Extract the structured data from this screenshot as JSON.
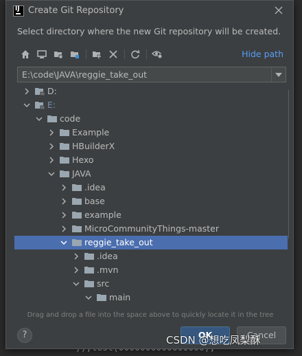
{
  "dialog": {
    "title": "Create Git Repository",
    "description": "Select directory where the new Git repository will be created.",
    "hide_path_label": "Hide path",
    "path_value": "E:\\code\\JAVA\\reggie_take_out",
    "hint": "Drag and drop a file into the space above to quickly locate it in the tree",
    "help_label": "?",
    "ok_label": "OK",
    "cancel_label": "Cancel"
  },
  "toolbar_icons": [
    "home-icon",
    "desktop-icon",
    "project-folder-icon",
    "module-folder-icon",
    "new-folder-icon",
    "delete-icon",
    "refresh-icon",
    "show-hidden-icon"
  ],
  "tree": {
    "items": [
      {
        "label": "D:",
        "expanded": false,
        "drive": true
      },
      {
        "label": "E:",
        "expanded": true,
        "drive": true
      },
      {
        "label": "code",
        "expanded": true
      },
      {
        "label": "Example",
        "expanded": false
      },
      {
        "label": "HBuilderX",
        "expanded": false
      },
      {
        "label": "Hexo",
        "expanded": false
      },
      {
        "label": "JAVA",
        "expanded": true
      },
      {
        "label": ".idea",
        "expanded": false
      },
      {
        "label": "base",
        "expanded": false
      },
      {
        "label": "example",
        "expanded": false
      },
      {
        "label": "MicroCommunityThings-master",
        "expanded": false
      },
      {
        "label": "reggie_take_out",
        "expanded": true,
        "selected": true
      },
      {
        "label": ".idea",
        "expanded": false
      },
      {
        "label": ".mvn",
        "expanded": false
      },
      {
        "label": "src",
        "expanded": true
      },
      {
        "label": "main",
        "expanded": true
      }
    ]
  },
  "editor": {
    "bottom_line": "));test(0000000000000000);"
  },
  "watermark": "CSDN @想吃凤梨酥",
  "colors": {
    "accent": "#589df6",
    "selection": "#4b6eaf",
    "ok_button": "#365880",
    "folder": "#9aa7b0"
  }
}
